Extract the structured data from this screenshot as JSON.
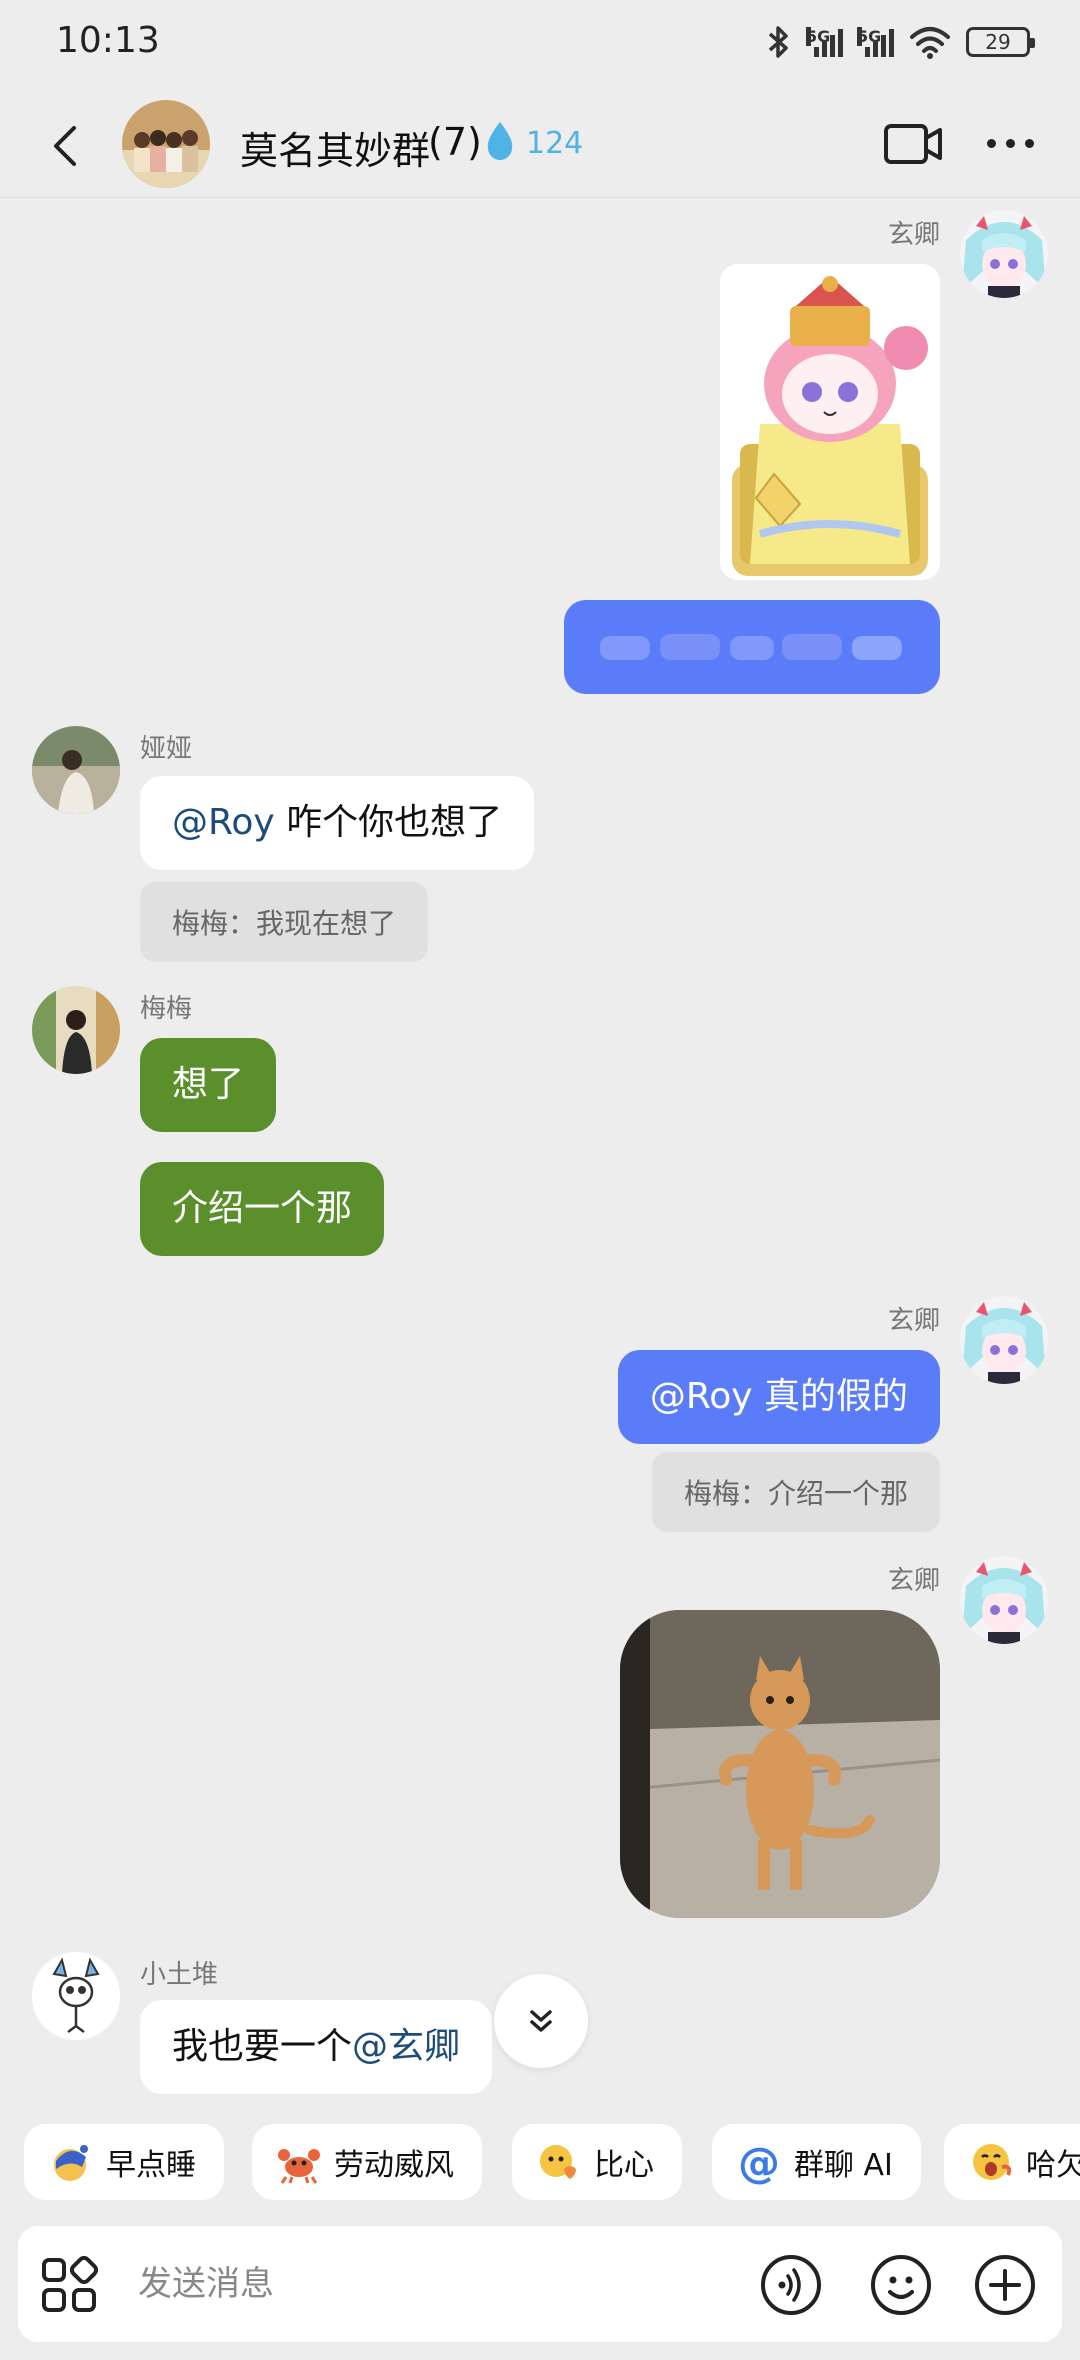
{
  "status_bar": {
    "time": "10:13",
    "signal_1_label": "5G",
    "signal_2_label": "5G",
    "battery": "29",
    "icons": [
      "bluetooth-icon",
      "signal-icon",
      "signal-icon",
      "wifi-icon",
      "battery-icon"
    ]
  },
  "header": {
    "group_name": "莫名其妙群",
    "member_count": "(7)",
    "fire_count": "124",
    "icons": [
      "back-icon",
      "drop-icon",
      "video-camera-icon",
      "more-icon"
    ]
  },
  "messages": [
    {
      "sender": "玄卿",
      "side": "right",
      "type": "sticker",
      "sticker": "anime-girl-throne-sticker"
    },
    {
      "side": "right",
      "type": "text",
      "text": "",
      "note": "blurred"
    },
    {
      "sender": "娅娅",
      "side": "left",
      "mention": "@Roy",
      "text": " 咋个你也想了",
      "quote": "梅梅：我现在想了"
    },
    {
      "sender": "梅梅",
      "side": "left",
      "texts": [
        "想了",
        "介绍一个那"
      ]
    },
    {
      "sender": "玄卿",
      "side": "right",
      "mention": "@Roy",
      "text": " 真的假的",
      "quote": "梅梅：介绍一个那"
    },
    {
      "sender": "玄卿",
      "side": "right",
      "type": "image",
      "image": "standing-cat-photo"
    },
    {
      "sender": "小土堆",
      "side": "left",
      "text": "我也要一个",
      "mention": "@玄卿"
    }
  ],
  "quick_chips": [
    {
      "label": "早点睡",
      "icon": "sleep-icon"
    },
    {
      "label": "劳动威风",
      "icon": "crab-icon"
    },
    {
      "label": "比心",
      "icon": "heart-hand-icon"
    },
    {
      "label": "群聊 AI",
      "icon": "at-icon"
    },
    {
      "label": "哈欠",
      "icon": "yawn-icon"
    }
  ],
  "input": {
    "placeholder": "发送消息",
    "icons": [
      "apps-icon",
      "voice-icon",
      "emoji-icon",
      "plus-icon"
    ]
  },
  "colors": {
    "background": "#ededed",
    "bubble_blue": "#5b7cf8",
    "bubble_green": "#5a8f2c",
    "mention": "#1e4c7a",
    "fire": "#4fb3e8"
  }
}
